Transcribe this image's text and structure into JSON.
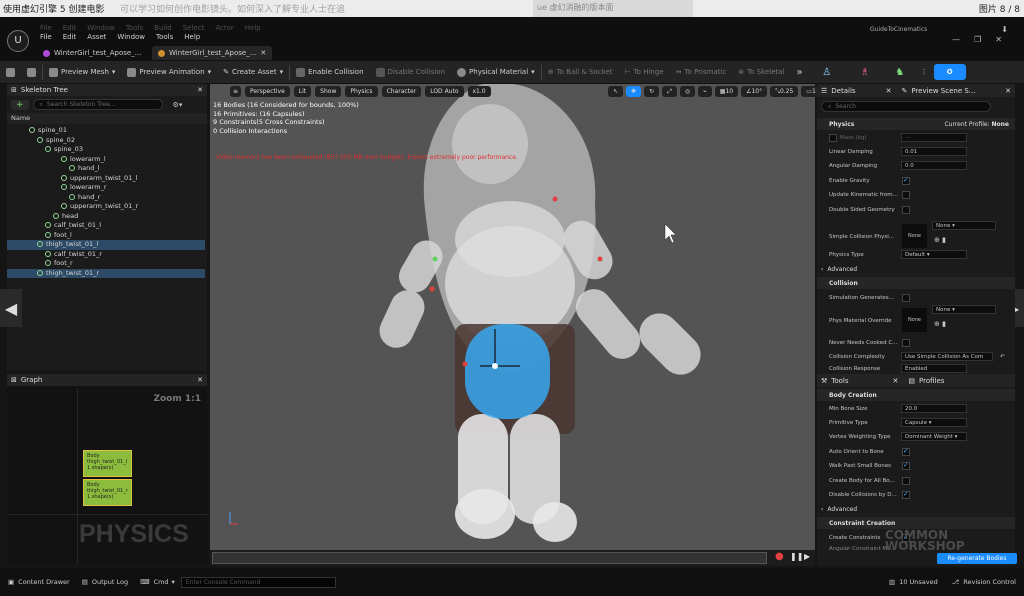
{
  "browser_bar": {
    "title": "使用虚幻引擎 5 创建电影",
    "overlay": "可以学习如何创作电影镜头。如何深入了解专业人士在追",
    "link_hint": "ue 虚幻消融的版本面",
    "page_counter": "图片 8 / 8"
  },
  "app": {
    "logo": "U",
    "menu": [
      "File",
      "Edit",
      "Asset",
      "Window",
      "Tools",
      "Help"
    ],
    "ghost_menu": [
      "File",
      "Edit",
      "Window",
      "Tools",
      "Build",
      "Select",
      "Actor",
      "Help"
    ],
    "guide": "GuideToCinematics",
    "tabs": [
      "WinterGirl_test_Apose_...",
      "WinterGirl_test_Apose_..."
    ]
  },
  "toolbar": {
    "items": [
      "Preview Mesh",
      "Preview Animation",
      "Create Asset",
      "Enable Collision",
      "Disable Collision",
      "Physical Material",
      "To Ball & Socket",
      "To Hinge",
      "To Prismatic",
      "To Skeletal"
    ]
  },
  "skeleton": {
    "title": "Skeleton Tree",
    "search_placeholder": "Search Skeleton Tree...",
    "column": "Name",
    "rows": [
      "spine_01",
      "spine_02",
      "spine_03",
      "lowerarm_l",
      "hand_l",
      "upperarm_twist_01_l",
      "lowerarm_r",
      "hand_r",
      "upperarm_twist_01_r",
      "head",
      "calf_twist_01_l",
      "foot_l",
      "thigh_twist_01_l",
      "calf_twist_01_r",
      "foot_r",
      "thigh_twist_01_r"
    ],
    "indent": [
      22,
      30,
      38,
      54,
      62,
      54,
      54,
      62,
      54,
      46,
      38,
      38,
      30,
      38,
      38,
      30
    ],
    "selected": [
      12,
      15
    ]
  },
  "graph": {
    "title": "Graph",
    "zoom": "Zoom 1:1",
    "watermark": "PHYSICS",
    "nodes": [
      {
        "l1": "Body",
        "l2": "thigh_twist_01_l",
        "l3": "1 shape(s)"
      },
      {
        "l1": "Body",
        "l2": "thigh_twist_01_r",
        "l3": "1 shape(s)"
      }
    ]
  },
  "viewport": {
    "perspective": "Perspective",
    "lit": "Lit",
    "show": "Show",
    "physics": "Physics",
    "character": "Character",
    "lod": "LOD Auto",
    "speed": "x1.0",
    "grid": "10",
    "angle": "10°",
    "scale": "0.25",
    "cam": "1",
    "stats": [
      "16 Bodies (16 Considered for bounds, 100%)",
      "16 Primitives: (16 Capsules)",
      "9 Constraints(5 Cross Constraints)",
      "0 Collision Interactions"
    ],
    "warning": "Video memory has been exhausted (857.505 MB over budget). Expect extremely poor performance."
  },
  "details": {
    "title": "Details",
    "tab2": "Preview Scene S...",
    "search_placeholder": "Search",
    "physics_cat": "Physics",
    "profile_label": "Current Profile:",
    "profile_value": "None",
    "mass": "Mass (kg)",
    "linear_damping": "Linear Damping",
    "linear_value": "0.01",
    "angular_damping": "Angular Damping",
    "angular_value": "0.0",
    "enable_gravity": "Enable Gravity",
    "update_kinematic": "Update Kinematic from...",
    "double_sided": "Double Sided Geometry",
    "simple_collision": "Simple Collision Physi...",
    "none": "None",
    "physics_type": "Physics Type",
    "default": "Default",
    "advanced": "Advanced",
    "collision_cat": "Collision",
    "sim_generates": "Simulation Generates...",
    "phys_material": "Phys Material Override",
    "never_cooked": "Never Needs Cooked C...",
    "complexity": "Collision Complexity",
    "complexity_val": "Use Simple Collision As Com",
    "response": "Collision Response",
    "enabled": "Enabled"
  },
  "tools": {
    "title": "Tools",
    "tab2": "Profiles",
    "body_creation": "Body Creation",
    "min_bone": "Min Bone Size",
    "min_bone_val": "20.0",
    "prim_type": "Primitive Type",
    "prim_val": "Capsule",
    "vertex_weight": "Vertex Weighting Type",
    "vertex_val": "Dominant Weight",
    "auto_orient": "Auto Orient to Bone",
    "walk_past": "Walk Past Small Bones",
    "create_body_all": "Create Body for All Bo...",
    "disable_coll": "Disable Collisions by D...",
    "advanced": "Advanced",
    "constraint_creation": "Constraint Creation",
    "create_constraints": "Create Constraints",
    "angular_constraint": "Angular Constraint Mo...",
    "regen": "Re-generate Bodies",
    "watermark": "COMMON WORKSHOP"
  },
  "bottom": {
    "content_drawer": "Content Drawer",
    "output_log": "Output Log",
    "cmd": "Cmd",
    "console_placeholder": "Enter Console Command",
    "unsaved": "10 Unsaved",
    "revision": "Revision Control"
  },
  "colors": {
    "accent": "#1a8cff",
    "selection": "#2d4a66",
    "node": "#8cbc3c",
    "warning": "#e03030",
    "blue_body": "#38a8f0"
  }
}
